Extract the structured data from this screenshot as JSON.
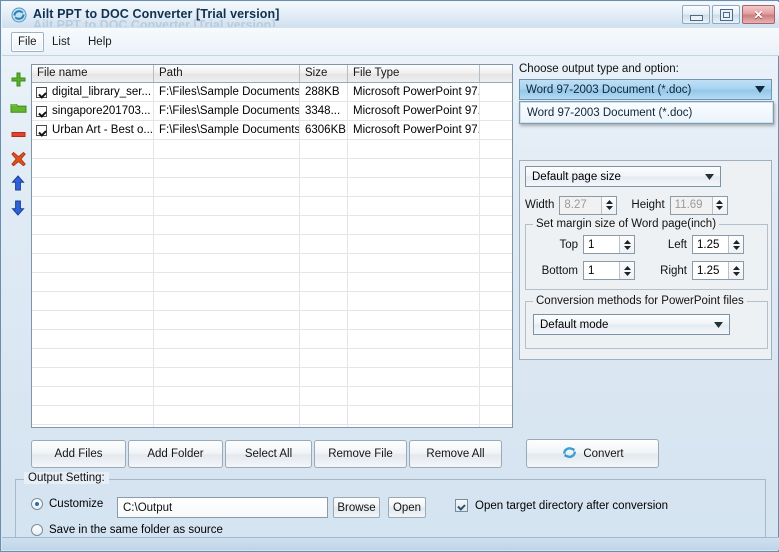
{
  "window": {
    "title": "Ailt PPT to DOC Converter [Trial version]",
    "icon": "convert-circular-arrows-icon",
    "controls": {
      "minimize": "minimize",
      "maximize": "maximize",
      "close": "close"
    }
  },
  "menubar": {
    "items": [
      {
        "label": "File",
        "active": true
      },
      {
        "label": "List",
        "active": false
      },
      {
        "label": "Help",
        "active": false
      }
    ]
  },
  "side_toolbar": {
    "items": [
      {
        "name": "add-file-icon",
        "glyph": "plus",
        "color": "#4aa226"
      },
      {
        "name": "add-folder-icon",
        "glyph": "folder",
        "color": "#5cb02e"
      },
      {
        "name": "remove-file-icon",
        "glyph": "minus",
        "color": "#d33a22"
      },
      {
        "name": "remove-all-icon",
        "glyph": "cross",
        "color": "#d84a1a"
      },
      {
        "name": "move-up-icon",
        "glyph": "arrow-up",
        "color": "#2457c6"
      },
      {
        "name": "move-down-icon",
        "glyph": "arrow-down",
        "color": "#2457c6"
      }
    ]
  },
  "file_list": {
    "columns": [
      "File name",
      "Path",
      "Size",
      "File Type",
      ""
    ],
    "rows": [
      {
        "checked": true,
        "file_name": "digital_library_ser...",
        "path": "F:\\Files\\Sample Documents...",
        "size": "288KB",
        "file_type": "Microsoft PowerPoint 97...",
        "extra": ""
      },
      {
        "checked": true,
        "file_name": "singapore201703...",
        "path": "F:\\Files\\Sample Documents...",
        "size": "3348...",
        "file_type": "Microsoft PowerPoint 97...",
        "extra": ""
      },
      {
        "checked": true,
        "file_name": "Urban Art - Best o...",
        "path": "F:\\Files\\Sample Documents...",
        "size": "6306KB",
        "file_type": "Microsoft PowerPoint 97...",
        "extra": ""
      }
    ],
    "empty_row_count": 16
  },
  "options": {
    "output_type_label": "Choose output type and option:",
    "output_type_selected": "Word 97-2003 Document (*.doc)",
    "output_type_options": [
      "Word 97-2003 Document (*.doc)"
    ],
    "page_size_selected": "Default page size",
    "width_label": "Width",
    "width_value": "8.27",
    "height_label": "Height",
    "height_value": "11.69",
    "margin_group_label": "Set margin size of Word page(inch)",
    "margins": {
      "top_label": "Top",
      "top_value": "1",
      "left_label": "Left",
      "left_value": "1.25",
      "bottom_label": "Bottom",
      "bottom_value": "1",
      "right_label": "Right",
      "right_value": "1.25"
    },
    "conversion_group_label": "Conversion methods for PowerPoint files",
    "conversion_mode_selected": "Default mode"
  },
  "actions": {
    "add_files": "Add Files",
    "add_folder": "Add Folder",
    "select_all": "Select All",
    "remove_file": "Remove File",
    "remove_all": "Remove All",
    "convert": "Convert"
  },
  "output_setting": {
    "legend": "Output Setting:",
    "customize_label": "Customize",
    "customize_selected": true,
    "path_value": "C:\\Output",
    "browse_label": "Browse",
    "open_label": "Open",
    "open_target_label": "Open target directory after conversion",
    "open_target_checked": true,
    "save_same_folder_label": "Save in the same folder as source",
    "save_same_folder_selected": false
  },
  "colors": {
    "accent_blue": "#a8d4f0",
    "close_red": "#cf7d80",
    "title_text": "#12304d"
  }
}
